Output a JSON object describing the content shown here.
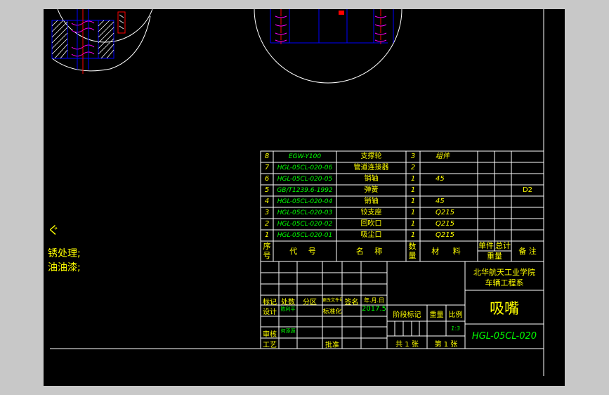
{
  "colors": {
    "background": "#000000",
    "frame": "#ffffff",
    "border_table": "#ffffff",
    "text_yellow": "#ffff00",
    "text_green": "#00ff00",
    "text_cyan": "#00ffff",
    "text_white": "#ffffff",
    "text_red": "#ff0000",
    "line_blue": "#0000ff",
    "line_red": "#ff0000",
    "line_magenta": "#ff00ff"
  },
  "notes": {
    "symbol": "ぐ",
    "line1": "锈处理;",
    "line2": "油油漆;"
  },
  "bom": {
    "rows": [
      {
        "no": "8",
        "code": "EGW-Y100",
        "name": "支撑轮",
        "qty": "3",
        "material": "组件",
        "unit_wt": "",
        "total_wt": "",
        "remark": ""
      },
      {
        "no": "7",
        "code": "HGL-05CL-020-06",
        "name": "管道连接器",
        "qty": "2",
        "material": "",
        "unit_wt": "",
        "total_wt": "",
        "remark": ""
      },
      {
        "no": "6",
        "code": "HGL-05CL-020-05",
        "name": "销轴",
        "qty": "1",
        "material": "45",
        "unit_wt": "",
        "total_wt": "",
        "remark": ""
      },
      {
        "no": "5",
        "code": "GB/T1239.6-1992",
        "name": "弹簧",
        "qty": "1",
        "material": "",
        "unit_wt": "",
        "total_wt": "",
        "remark": "D2"
      },
      {
        "no": "4",
        "code": "HGL-05CL-020-04",
        "name": "销轴",
        "qty": "1",
        "material": "45",
        "unit_wt": "",
        "total_wt": "",
        "remark": ""
      },
      {
        "no": "3",
        "code": "HGL-05CL-020-03",
        "name": "铰支座",
        "qty": "1",
        "material": "Q215",
        "unit_wt": "",
        "total_wt": "",
        "remark": ""
      },
      {
        "no": "2",
        "code": "HGL-05CL-020-02",
        "name": "回吹口",
        "qty": "1",
        "material": "Q215",
        "unit_wt": "",
        "total_wt": "",
        "remark": ""
      },
      {
        "no": "1",
        "code": "HGL-05CL-020-01",
        "name": "吸尘口",
        "qty": "1",
        "material": "Q215",
        "unit_wt": "",
        "total_wt": "",
        "remark": ""
      }
    ],
    "header": {
      "no": "序号",
      "code": "代 号",
      "name": "名 称",
      "qty": "数量",
      "material": "材 料",
      "unit_wt": "单件",
      "total_wt": "总计",
      "weight": "重量",
      "remark": "备 注"
    }
  },
  "title_block": {
    "school": "北华航天工业学院",
    "department": "车辆工程系",
    "drawing_name": "吸嘴",
    "drawing_code": "HGL-05CL-020",
    "scale_label": "比例",
    "scale": "1:3",
    "weight_label": "重量",
    "stage_label": "阶段标记",
    "sheets": "共 1 张",
    "sheet": "第 1 张",
    "rev_headers": [
      "标记",
      "处数",
      "分区",
      "更改文件号",
      "签名",
      "年.月.日"
    ],
    "design_label": "设计",
    "designer": "陈利平",
    "std_label": "标准化",
    "date": "2017.5",
    "review_label": "审核",
    "reviewer": "何添源",
    "process_label": "工艺",
    "approve_label": "批准"
  }
}
